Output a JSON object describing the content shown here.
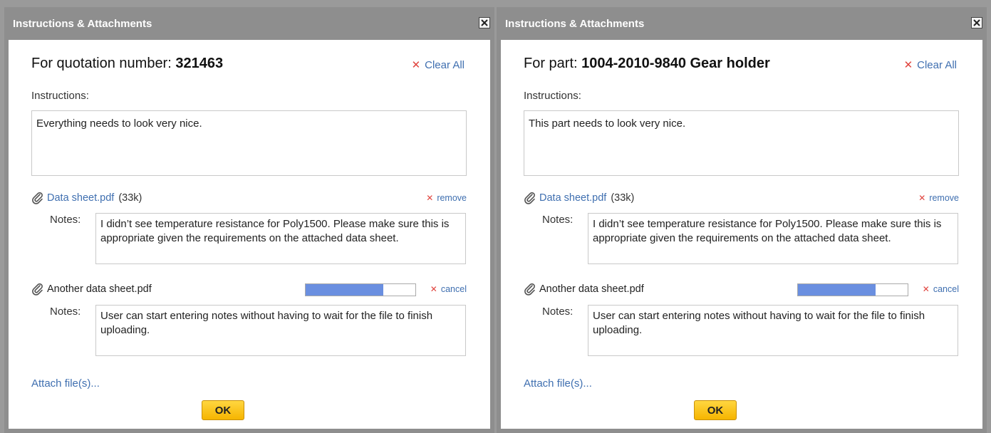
{
  "dialogs": [
    {
      "title": "Instructions & Attachments",
      "heading_prefix": "For quotation number: ",
      "heading_value": "321463",
      "clear_all": "Clear All",
      "instructions_label": "Instructions:",
      "instructions_text": "Everything needs to look very nice.",
      "file1": {
        "name": "Data sheet.pdf",
        "size": "(33k)",
        "action": "remove"
      },
      "notes_label": "Notes:",
      "file1_notes": "I didn’t see temperature resistance for Poly1500. Please make sure this is appropriate given the requirements on the attached data sheet.",
      "file2": {
        "name": "Another data sheet.pdf",
        "progress": 0.71,
        "action": "cancel"
      },
      "file2_notes": "User can start entering notes without having to wait for the file to finish uploading.",
      "attach": "Attach file(s)...",
      "ok": "OK"
    },
    {
      "title": "Instructions & Attachments",
      "heading_prefix": "For part: ",
      "heading_value": "1004-2010-9840 Gear holder",
      "clear_all": "Clear All",
      "instructions_label": "Instructions:",
      "instructions_text": "This part needs to look very nice.",
      "file1": {
        "name": "Data sheet.pdf",
        "size": "(33k)",
        "action": "remove"
      },
      "notes_label": "Notes:",
      "file1_notes": "I didn’t see temperature resistance for Poly1500. Please make sure this is appropriate given the requirements on the attached data sheet.",
      "file2": {
        "name": "Another data sheet.pdf",
        "progress": 0.71,
        "action": "cancel"
      },
      "file2_notes": "User can start entering notes without having to wait for the file to finish uploading.",
      "attach": "Attach file(s)...",
      "ok": "OK"
    }
  ],
  "colors": {
    "link": "#3f6fb0",
    "x_red": "#e0443e",
    "ok_bg": "#f6b500",
    "progress_fill": "#6a8fe0",
    "titlebar": "#8e8e8e"
  }
}
